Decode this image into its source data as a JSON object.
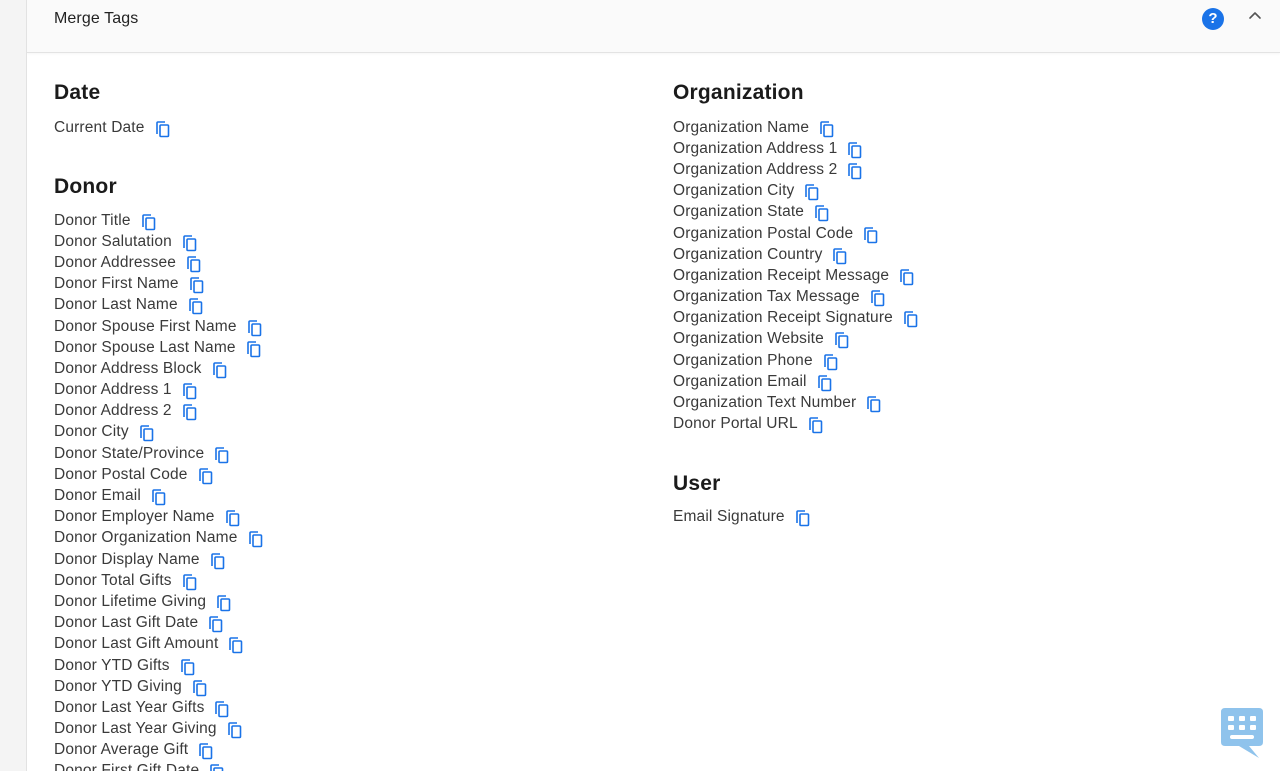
{
  "header": {
    "title": "Merge Tags",
    "help_label": "?",
    "help_icon": "question-circle-icon",
    "collapse_icon": "chevron-up-icon"
  },
  "colors": {
    "accent": "#1a73e8",
    "copy_icon": "#1a73e8",
    "chat_widget": "#8fc3ec"
  },
  "sections": {
    "date": {
      "title": "Date",
      "items": [
        "Current Date"
      ]
    },
    "donor": {
      "title": "Donor",
      "items": [
        "Donor Title",
        "Donor Salutation",
        "Donor Addressee",
        "Donor First Name",
        "Donor Last Name",
        "Donor Spouse First Name",
        "Donor Spouse Last Name",
        "Donor Address Block",
        "Donor Address 1",
        "Donor Address 2",
        "Donor City",
        "Donor State/Province",
        "Donor Postal Code",
        "Donor Email",
        "Donor Employer Name",
        "Donor Organization Name",
        "Donor Display Name",
        "Donor Total Gifts",
        "Donor Lifetime Giving",
        "Donor Last Gift Date",
        "Donor Last Gift Amount",
        "Donor YTD Gifts",
        "Donor YTD Giving",
        "Donor Last Year Gifts",
        "Donor Last Year Giving",
        "Donor Average Gift",
        "Donor First Gift Date"
      ]
    },
    "organization": {
      "title": "Organization",
      "items": [
        "Organization Name",
        "Organization Address 1",
        "Organization Address 2",
        "Organization City",
        "Organization State",
        "Organization Postal Code",
        "Organization Country",
        "Organization Receipt Message",
        "Organization Tax Message",
        "Organization Receipt Signature",
        "Organization Website",
        "Organization Phone",
        "Organization Email",
        "Organization Text Number",
        "Donor Portal URL"
      ]
    },
    "user": {
      "title": "User",
      "items": [
        "Email Signature"
      ]
    }
  },
  "chat_widget": {
    "icon": "chat-bubble-icon"
  }
}
